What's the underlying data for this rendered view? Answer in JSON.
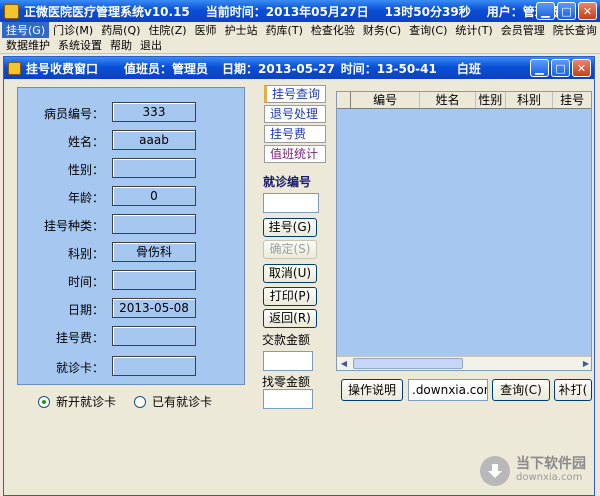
{
  "window": {
    "title": "正微医院医疗管理系统v10.15",
    "time_text": "当前时间：2013年05月27日",
    "clock": "13时50分39秒",
    "user_text": "用户：管理员"
  },
  "menu": {
    "row1": [
      "挂号(G)",
      "门诊(M)",
      "药局(Q)",
      "住院(Z)",
      "医师",
      "护士站",
      "药库(T)",
      "检查化验",
      "财务(C)",
      "查询(C)",
      "统计(T)",
      "会员管理",
      "院长查询"
    ],
    "row2": [
      "数据维护",
      "系统设置",
      "帮助",
      "退出"
    ]
  },
  "inner": {
    "title": "挂号收费窗口",
    "operator": "值班员：管理员",
    "date": "日期：2013-05-27",
    "time": "时间：13-50-41",
    "shift": "白班"
  },
  "patient": {
    "fields": [
      {
        "label": "病员编号：",
        "value": "333"
      },
      {
        "label": "姓名：",
        "value": "aaab"
      },
      {
        "label": "性别：",
        "value": ""
      },
      {
        "label": "年龄：",
        "value": "0"
      },
      {
        "label": "挂号种类：",
        "value": ""
      },
      {
        "label": "科别：",
        "value": "骨伤科"
      },
      {
        "label": "时间：",
        "value": ""
      },
      {
        "label": "日期：",
        "value": "2013-05-08"
      },
      {
        "label": "挂号费：",
        "value": ""
      },
      {
        "label": "就诊卡：",
        "value": ""
      }
    ]
  },
  "radios": {
    "new_card": "新开就诊卡",
    "has_card": "已有就诊卡"
  },
  "tabs": [
    "挂号查询",
    "退号处理",
    "挂号费",
    "值班统计"
  ],
  "actions": {
    "visit_no_label": "就诊编号",
    "register": "挂号(G)",
    "confirm": "确定(S)",
    "cancel": "取消(U)",
    "print": "打印(P)",
    "back": "返回(R)",
    "paid_label": "交款金额",
    "change_label": "找零金额"
  },
  "grid": {
    "columns": [
      "编号",
      "姓名",
      "性别",
      "科别",
      "挂号"
    ]
  },
  "bottom": {
    "manual": "操作说明",
    "url": ".downxia.com",
    "query": "查询(C)",
    "reprint": "补打("
  },
  "watermark": {
    "main": "当下软件园",
    "sub": "downxia.com"
  }
}
